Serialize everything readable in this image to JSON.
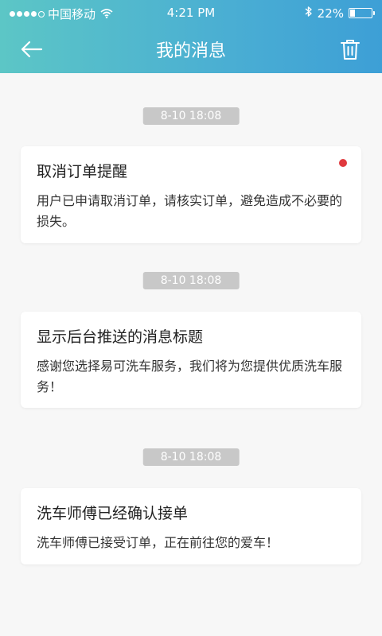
{
  "status_bar": {
    "carrier": "中国移动",
    "time": "4:21 PM",
    "battery": "22%",
    "battery_level": 0.22
  },
  "nav": {
    "title": "我的消息",
    "back_icon": "arrow-left-icon",
    "trash_icon": "trash-icon"
  },
  "messages": [
    {
      "time": "8-10 18:08",
      "title": "取消订单提醒",
      "body": "用户已申请取消订单，请核实订单，避免造成不必要的损失。",
      "unread": true
    },
    {
      "time": "8-10 18:08",
      "title": "显示后台推送的消息标题",
      "body": "感谢您选择易可洗车服务，我们将为您提供优质洗车服务！",
      "unread": false
    },
    {
      "time": "8-10 18:08",
      "title": "洗车师傅已经确认接单",
      "body": "洗车师傅已接受订单，正在前往您的爱车！",
      "unread": false
    }
  ],
  "colors": {
    "header_start": "#5cc6c6",
    "header_end": "#3d9fd6",
    "unread": "#e0393e",
    "chip": "#c8c8c8"
  }
}
